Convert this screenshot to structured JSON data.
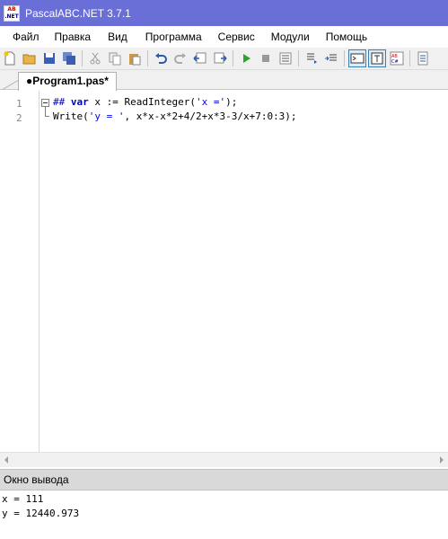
{
  "window": {
    "title": "PascalABC.NET 3.7.1",
    "icon": "pascalabc-app-icon"
  },
  "menu": {
    "items": [
      {
        "label": "Файл"
      },
      {
        "label": "Правка"
      },
      {
        "label": "Вид"
      },
      {
        "label": "Программа"
      },
      {
        "label": "Сервис"
      },
      {
        "label": "Модули"
      },
      {
        "label": "Помощь"
      }
    ]
  },
  "toolbar": {
    "buttons": [
      "new-file-icon",
      "open-folder-icon",
      "save-icon",
      "save-all-icon",
      "cut-icon",
      "copy-icon",
      "paste-icon",
      "undo-icon",
      "redo-icon",
      "unindent-icon",
      "indent-icon",
      "run-icon",
      "stop-icon",
      "compile-icon",
      "step-into-icon",
      "step-over-icon",
      "console-toggle-icon",
      "text-toggle-icon",
      "abc-toggle-icon",
      "help-icon"
    ],
    "active": [
      "console-toggle-icon",
      "text-toggle-icon"
    ]
  },
  "tabs": [
    {
      "label": "●Program1.pas*"
    }
  ],
  "editor": {
    "lines": [
      {
        "number": "1",
        "tokens": [
          {
            "text": "## ",
            "kind": "keyword"
          },
          {
            "text": "var",
            "kind": "keyword"
          },
          {
            "text": " x := ReadInteger(",
            "kind": "plain"
          },
          {
            "text": "'x ='",
            "kind": "string"
          },
          {
            "text": ");",
            "kind": "plain"
          }
        ]
      },
      {
        "number": "2",
        "tokens": [
          {
            "text": "Write(",
            "kind": "plain"
          },
          {
            "text": "'y = '",
            "kind": "string"
          },
          {
            "text": ", x*x-x*2+4/2+x*3-3/x+7:0:3);",
            "kind": "plain"
          }
        ]
      }
    ]
  },
  "output": {
    "title": "Окно вывода",
    "lines": [
      "x = 111",
      "y = 12440.973"
    ]
  },
  "colors": {
    "titlebar": "#6a6fd8",
    "keyword": "#0000c0",
    "string": "#0000ff",
    "output_header": "#d9d9d9"
  }
}
